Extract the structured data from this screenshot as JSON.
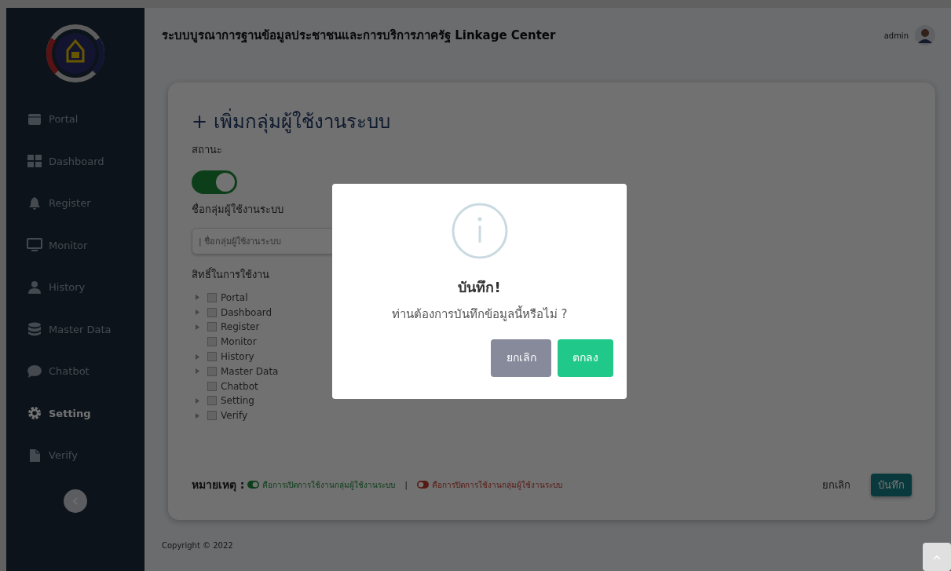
{
  "sidebar": {
    "items": [
      {
        "label": "Portal",
        "selected": false
      },
      {
        "label": "Dashboard",
        "selected": false
      },
      {
        "label": "Register",
        "selected": false
      },
      {
        "label": "Monitor",
        "selected": false
      },
      {
        "label": "History",
        "selected": false
      },
      {
        "label": "Master Data",
        "selected": false
      },
      {
        "label": "Chatbot",
        "selected": false
      },
      {
        "label": "Setting",
        "selected": true
      },
      {
        "label": "Verify",
        "selected": false
      }
    ]
  },
  "header": {
    "title": "ระบบบูรณาการฐานข้อมูลประชาชนและการบริการภาครัฐ Linkage Center",
    "user": "admin"
  },
  "form": {
    "heading": "+ เพิ่มกลุ่มผู้ใช้งานระบบ",
    "status_label": "สถานะ",
    "status_on": true,
    "name_label": "ชื่อกลุ่มผู้ใช้งานระบบ",
    "name_placeholder": "| ชื่อกลุ่มผู้ใช้งานระบบ",
    "permissions_label": "สิทธิ์ในการใช้งาน",
    "permissions": [
      {
        "label": "Portal",
        "expandable": true,
        "checked": false
      },
      {
        "label": "Dashboard",
        "expandable": true,
        "checked": false
      },
      {
        "label": "Register",
        "expandable": true,
        "checked": false
      },
      {
        "label": "Monitor",
        "expandable": false,
        "checked": false
      },
      {
        "label": "History",
        "expandable": true,
        "checked": false
      },
      {
        "label": "Master Data",
        "expandable": true,
        "checked": false
      },
      {
        "label": "Chatbot",
        "expandable": false,
        "checked": false
      },
      {
        "label": "Setting",
        "expandable": true,
        "checked": false
      },
      {
        "label": "Verify",
        "expandable": true,
        "checked": false
      }
    ],
    "note": {
      "label": "หมายเหตุ :",
      "on_text": "คือการเปิดการใช้งานกลุ่มผู้ใช้งานระบบ",
      "separator": "|",
      "off_text": "คือการปิดการใช้งานกลุ่มผู้ใช้งานระบบ"
    },
    "cancel": "ยกเลิก",
    "save": "บันทึก"
  },
  "footer": "Copyright © 2022",
  "dialog": {
    "title": "บันทึก!",
    "message": "ท่านต้องการบันทึกข้อมูลนี้หรือไม่ ?",
    "cancel": "ยกเลิก",
    "confirm": "ตกลง"
  }
}
